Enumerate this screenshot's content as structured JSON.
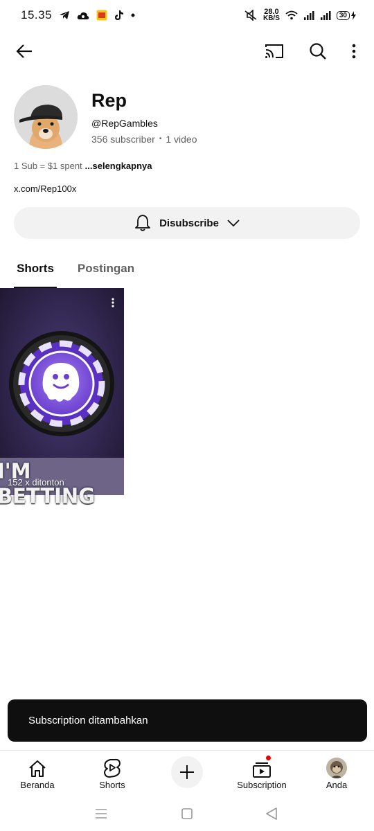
{
  "status_bar": {
    "time": "15.35",
    "net_speed_value": "28.0",
    "net_speed_unit": "KB/S",
    "battery": "30",
    "notification_icons": [
      "telegram-icon",
      "cloud-icon",
      "app-badge-icon",
      "tiktok-icon",
      "dot-icon"
    ],
    "system_icons": [
      "mute-icon",
      "wifi-icon",
      "signal-icon",
      "signal-icon",
      "battery-icon"
    ]
  },
  "app_bar": {
    "back_icon": "arrow-left-icon",
    "actions": [
      "cast-icon",
      "search-icon",
      "more-vertical-icon"
    ]
  },
  "channel": {
    "name": "Rep",
    "handle": "@RepGambles",
    "subscribers": "356 subscriber",
    "separator": "•",
    "videos": "1 video",
    "description": "1 Sub = $1 spent",
    "description_more": "...selengkapnya",
    "link": "x.com/Rep100x"
  },
  "subscribe_button": {
    "label": "Disubscribe",
    "icon": "bell-icon",
    "dropdown_icon": "chevron-down-icon"
  },
  "tabs": [
    {
      "label": "Shorts",
      "selected": true
    },
    {
      "label": "Postingan",
      "selected": false
    }
  ],
  "shorts": [
    {
      "overlay_text": "I'M BETTING",
      "views": "152 x ditonton",
      "accent": "#7b4fd6"
    }
  ],
  "snackbar": {
    "text": "Subscription ditambahkan"
  },
  "bottom_nav": [
    {
      "label": "Beranda",
      "icon": "home-icon"
    },
    {
      "label": "Shorts",
      "icon": "shorts-icon"
    },
    {
      "label": "",
      "icon": "plus-icon"
    },
    {
      "label": "Subscription",
      "icon": "subscriptions-icon",
      "badge": true
    },
    {
      "label": "Anda",
      "icon": "avatar-icon"
    }
  ],
  "colors": {
    "text_primary": "#0f0f0f",
    "text_secondary": "#606060",
    "chip_bg": "#f2f2f2",
    "snackbar_bg": "#0f0f0f",
    "badge": "#ee0000"
  }
}
